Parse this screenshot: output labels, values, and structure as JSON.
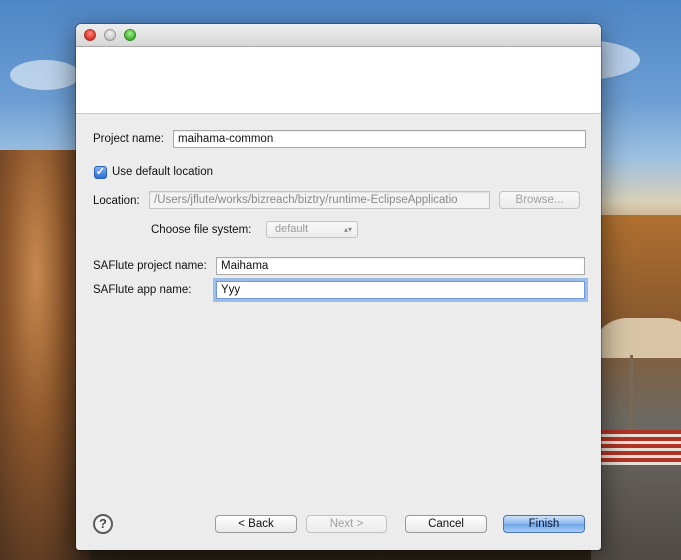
{
  "form": {
    "project_name_label": "Project name:",
    "project_name_value": "maihama-common",
    "use_default_location_label": "Use default location",
    "use_default_location_checked": true,
    "location_label": "Location:",
    "location_value": "/Users/jflute/works/bizreach/biztry/runtime-EclipseApplicatio",
    "browse_label": "Browse...",
    "choose_file_system_label": "Choose file system:",
    "file_system_value": "default",
    "saflute_project_name_label": "SAFlute project name:",
    "saflute_project_name_value": "Maihama",
    "saflute_app_name_label": "SAFlute app name:",
    "saflute_app_name_value": "Yyy"
  },
  "footer": {
    "help_icon_text": "?",
    "back_label": "< Back",
    "next_label": "Next >",
    "cancel_label": "Cancel",
    "finish_label": "Finish"
  },
  "icons": {
    "check": "✓",
    "select_arrows": "▴▾"
  }
}
